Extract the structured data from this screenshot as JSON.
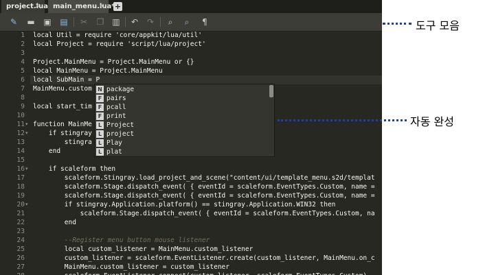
{
  "tabs": [
    {
      "label": "project.lua"
    },
    {
      "label": "main_menu.lua*"
    }
  ],
  "tab_add_label": "+",
  "toolbar": {
    "icons": [
      "new-file-icon",
      "open-folder-icon",
      "save-icon",
      "save-all-icon",
      "cut-icon",
      "copy-icon",
      "paste-icon",
      "undo-icon",
      "redo-icon",
      "find-icon",
      "find-replace-icon",
      "pilcrow-icon"
    ]
  },
  "lines": [
    {
      "n": "1",
      "text": "local Util = require 'core/appkit/lua/util'",
      "kind": "code",
      "fold": ""
    },
    {
      "n": "2",
      "text": "local Project = require 'script/lua/project'",
      "kind": "code",
      "fold": ""
    },
    {
      "n": "3",
      "text": "",
      "kind": "code",
      "fold": ""
    },
    {
      "n": "4",
      "text": "Project.MainMenu = Project.MainMenu or {}",
      "kind": "code",
      "fold": ""
    },
    {
      "n": "5",
      "text": "local MainMenu = Project.MainMenu",
      "kind": "code",
      "fold": ""
    },
    {
      "n": "6",
      "text": "local SubMain = P",
      "kind": "code",
      "fold": ""
    },
    {
      "n": "7",
      "text": "MainMenu.custom",
      "kind": "code",
      "fold": ""
    },
    {
      "n": "8",
      "text": "",
      "kind": "code",
      "fold": ""
    },
    {
      "n": "9",
      "text": "local start_tim",
      "kind": "code",
      "fold": ""
    },
    {
      "n": "10",
      "text": "",
      "kind": "code",
      "fold": ""
    },
    {
      "n": "11",
      "text": "function MainMe",
      "kind": "code",
      "fold": "▾"
    },
    {
      "n": "12",
      "text": "    if stingray",
      "kind": "code",
      "fold": "▾"
    },
    {
      "n": "13",
      "text": "        stingra",
      "kind": "code",
      "fold": ""
    },
    {
      "n": "14",
      "text": "    end",
      "kind": "code",
      "fold": ""
    },
    {
      "n": "15",
      "text": "",
      "kind": "code",
      "fold": ""
    },
    {
      "n": "16",
      "text": "    if scaleform then",
      "kind": "code",
      "fold": "▾"
    },
    {
      "n": "17",
      "text": "        scaleform.Stingray.load_project_and_scene(\"content/ui/template_menu.s2d/templat",
      "kind": "code",
      "fold": ""
    },
    {
      "n": "18",
      "text": "        scaleform.Stage.dispatch_event( { eventId = scaleform.EventTypes.Custom, name =",
      "kind": "code",
      "fold": ""
    },
    {
      "n": "19",
      "text": "        scaleform.Stage.dispatch_event( { eventId = scaleform.EventTypes.Custom, name =",
      "kind": "code",
      "fold": ""
    },
    {
      "n": "20",
      "text": "        if stingray.Application.platform() == stingray.Application.WIN32 then",
      "kind": "code",
      "fold": "▾"
    },
    {
      "n": "21",
      "text": "            scaleform.Stage.dispatch_event( { eventId = scaleform.EventTypes.Custom, na",
      "kind": "code",
      "fold": ""
    },
    {
      "n": "22",
      "text": "        end",
      "kind": "code",
      "fold": ""
    },
    {
      "n": "23",
      "text": "",
      "kind": "code",
      "fold": ""
    },
    {
      "n": "24",
      "text": "        --Register menu button mouse listener",
      "kind": "comment",
      "fold": ""
    },
    {
      "n": "25",
      "text": "        local custom_listener = MainMenu.custom_listener",
      "kind": "code",
      "fold": ""
    },
    {
      "n": "26",
      "text": "        custom_listener = scaleform.EventListener.create(custom_listener, MainMenu.on_c",
      "kind": "code",
      "fold": ""
    },
    {
      "n": "27",
      "text": "        MainMenu.custom_listener = custom_listener",
      "kind": "code",
      "fold": ""
    },
    {
      "n": "28",
      "text": "        scaleform.EventListener.connect(custom_listener, scaleform.EventTypes.Custom)",
      "kind": "code",
      "fold": ""
    }
  ],
  "autocomplete": {
    "items": [
      {
        "kind": "N",
        "label": "package"
      },
      {
        "kind": "F",
        "label": "pairs"
      },
      {
        "kind": "F",
        "label": "pcall"
      },
      {
        "kind": "F",
        "label": "print"
      },
      {
        "kind": "L",
        "label": "Project"
      },
      {
        "kind": "L",
        "label": "project"
      },
      {
        "kind": "L",
        "label": "Play"
      },
      {
        "kind": "L",
        "label": "plat"
      }
    ]
  },
  "annotations": {
    "toolbar_label": "도구 모음",
    "autocomplete_label": "자동 완성"
  },
  "colors": {
    "editor_bg": "#272822",
    "annotation_line": "#1e3faa"
  }
}
